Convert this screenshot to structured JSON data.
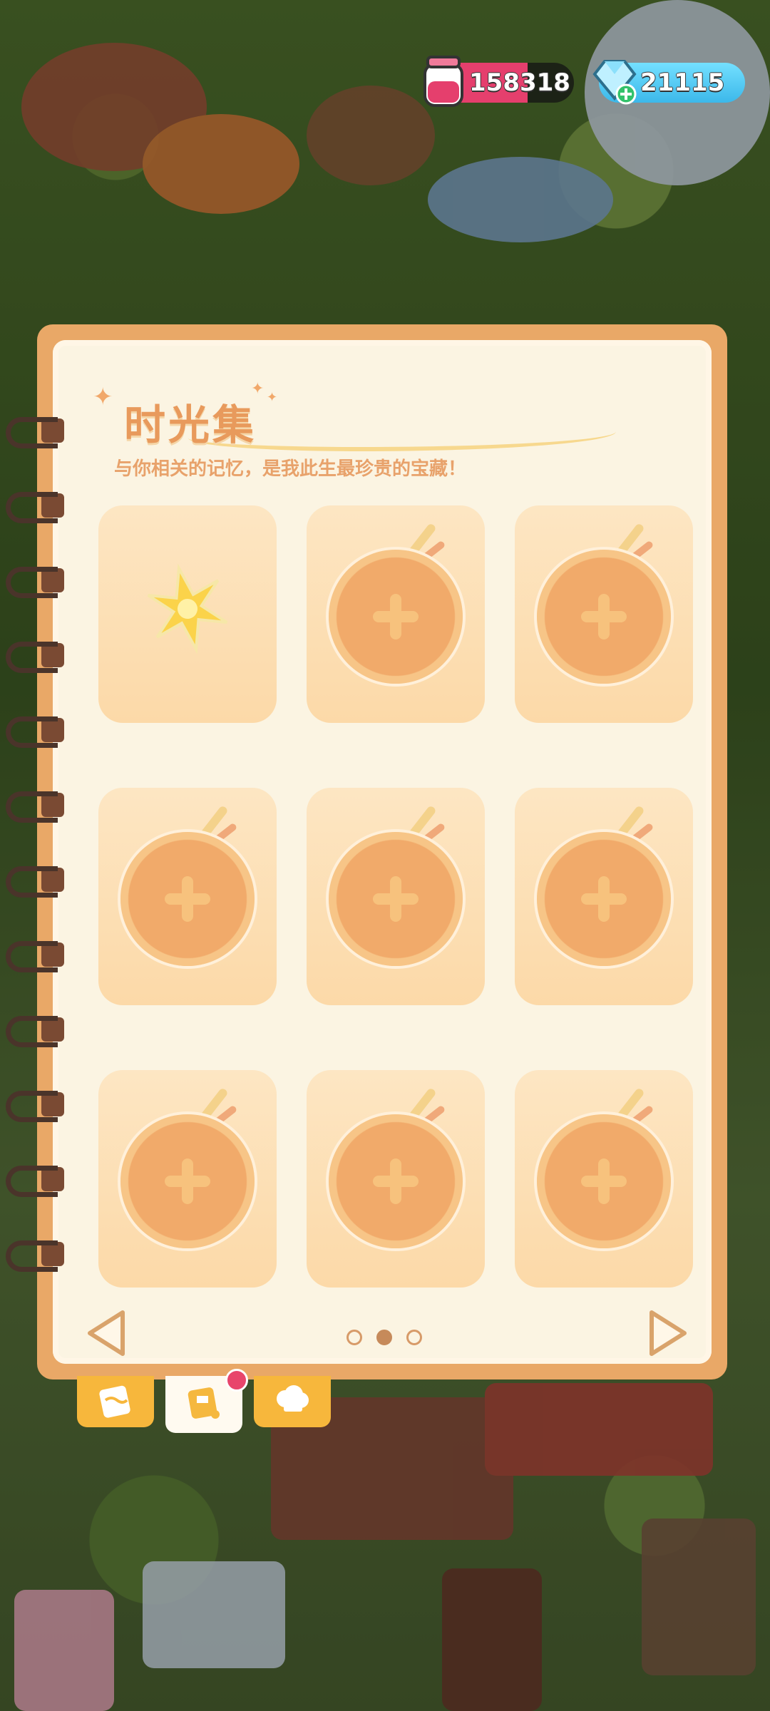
{
  "currency": {
    "jam": {
      "value": "158318",
      "icon": "jam-jar-icon",
      "color": "#e53f6d"
    },
    "gems": {
      "value": "21115",
      "icon": "diamond-plus-icon",
      "color": "#4cc7f2"
    }
  },
  "notebook": {
    "title": "时光集",
    "subtitle": "与你相关的记忆，是我此生最珍贵的宝藏！",
    "slots": [
      {
        "state": "filled",
        "icon": "golden-snowflake-icon"
      },
      {
        "state": "empty",
        "icon": "pie-plus-icon"
      },
      {
        "state": "empty",
        "icon": "pie-plus-icon"
      },
      {
        "state": "empty",
        "icon": "pie-plus-icon"
      },
      {
        "state": "empty",
        "icon": "pie-plus-icon"
      },
      {
        "state": "empty",
        "icon": "pie-plus-icon"
      },
      {
        "state": "empty",
        "icon": "pie-plus-icon"
      },
      {
        "state": "empty",
        "icon": "pie-plus-icon"
      },
      {
        "state": "empty",
        "icon": "pie-plus-icon"
      }
    ],
    "pagination": {
      "pages": 3,
      "current": 2
    }
  },
  "tabs": [
    {
      "name": "book-tab",
      "icon": "book-icon",
      "active": false
    },
    {
      "name": "album-tab",
      "icon": "album-icon",
      "active": true,
      "badge": true
    },
    {
      "name": "chef-tab",
      "icon": "chef-hat-icon",
      "active": false
    }
  ],
  "colors": {
    "cover": "#e9a867",
    "page": "#fbf4e2",
    "slot": "#fde6c3",
    "accent": "#e89a5c"
  }
}
